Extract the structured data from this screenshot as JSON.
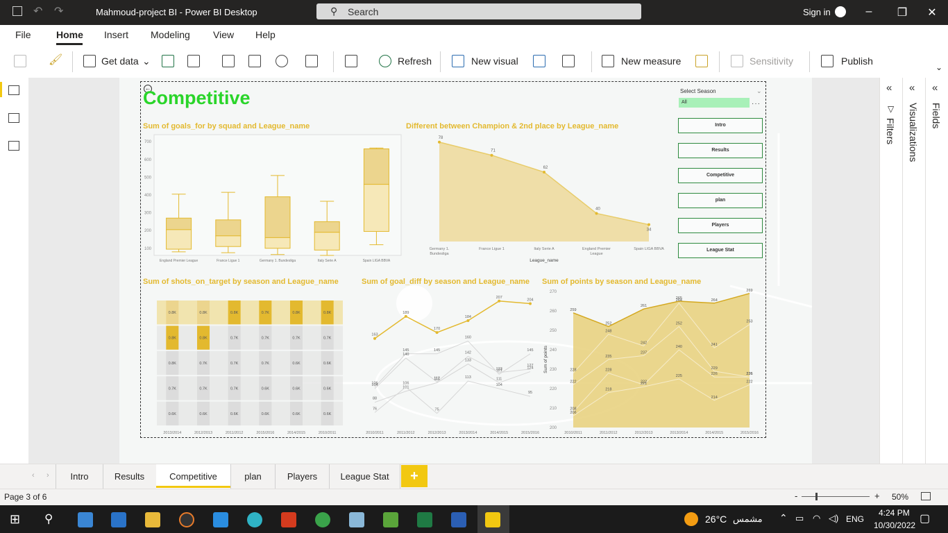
{
  "titlebar": {
    "title": "Mahmoud-project BI - Power BI Desktop",
    "search_placeholder": "Search",
    "sign_in": "Sign in"
  },
  "menu": {
    "items": [
      "File",
      "Home",
      "Insert",
      "Modeling",
      "View",
      "Help"
    ],
    "active": "Home"
  },
  "ribbon": {
    "get_data": "Get data",
    "refresh": "Refresh",
    "new_visual": "New visual",
    "new_measure": "New measure",
    "sensitivity": "Sensitivity",
    "publish": "Publish"
  },
  "report": {
    "page_title": "Competitive",
    "slicer": {
      "title": "Select Season",
      "value": "All"
    },
    "nav_buttons": [
      "Intro",
      "Results",
      "Competitive",
      "plan",
      "Players",
      "League Stat"
    ]
  },
  "panes": {
    "filters": "Filters",
    "visualizations": "Visualizations",
    "fields": "Fields"
  },
  "tabs": {
    "items": [
      "Intro",
      "Results",
      "Competitive",
      "plan",
      "Players",
      "League Stat"
    ],
    "active": "Competitive",
    "add": "+"
  },
  "status": {
    "page": "Page 3 of 6",
    "zoom": "50%"
  },
  "taskbar": {
    "temp": "26°C",
    "weather": "مشمس",
    "lang": "ENG",
    "time": "4:24 PM",
    "date": "10/30/2022"
  },
  "colors": {
    "accent": "#f2c811",
    "title_green": "#2ad52a",
    "chart_gold": "#e3b92f"
  },
  "chart_data": [
    {
      "type": "box",
      "title": "Sum of goals_for by squad and League_name",
      "categories": [
        "England Premier League",
        "France Ligue 1",
        "Germany 1. Bundesliga",
        "Italy Serie A",
        "Spain LIGA BBVA"
      ],
      "yticks": [
        "700",
        "600",
        "500",
        "400",
        "300",
        "200",
        "100"
      ],
      "ylim": [
        60,
        740
      ],
      "boxes": [
        {
          "min": 80,
          "q1": 95,
          "median": 205,
          "q3": 270,
          "max": 405
        },
        {
          "min": 75,
          "q1": 110,
          "median": 170,
          "q3": 260,
          "max": 415
        },
        {
          "min": 65,
          "q1": 100,
          "median": 160,
          "q3": 390,
          "max": 510
        },
        {
          "min": 60,
          "q1": 90,
          "median": 190,
          "q3": 250,
          "max": 365
        },
        {
          "min": 120,
          "q1": 195,
          "median": 460,
          "q3": 660,
          "max": 665
        }
      ]
    },
    {
      "type": "area",
      "title": "Different between Champion & 2nd place by League_name",
      "xlabel": "League_name",
      "categories": [
        "Germany 1. Bundesliga",
        "France Ligue 1",
        "Italy Serie A",
        "England Premier League",
        "Spain LIGA BBVA"
      ],
      "values": [
        78,
        71,
        62,
        40,
        34
      ],
      "ylim": [
        25,
        82
      ]
    },
    {
      "type": "ribbon",
      "title": "Sum of shots_on_target by season and League_name",
      "categories": [
        "2013/2014",
        "2012/2013",
        "2011/2012",
        "2015/2016",
        "2014/2015",
        "2010/2011"
      ],
      "labels": [
        [
          "0.8K",
          "0.8K",
          "0.8K",
          "0.7K",
          "0.6K"
        ],
        [
          "0.8K",
          "0.8K",
          "0.7K",
          "0.7K",
          "0.6K"
        ],
        [
          "0.8K",
          "0.7K",
          "0.7K",
          "0.7K",
          "0.6K"
        ],
        [
          "0.7K",
          "0.7K",
          "0.7K",
          "0.6K",
          "0.6K"
        ],
        [
          "0.8K",
          "0.7K",
          "0.6K",
          "0.6K",
          "0.6K"
        ],
        [
          "0.8K",
          "0.7K",
          "0.6K",
          "0.6K",
          "0.6K"
        ]
      ]
    },
    {
      "type": "line",
      "title": "Sum of goal_diff by season and League_name",
      "x": [
        "2010/2011",
        "2011/2012",
        "2012/2013",
        "2013/2014",
        "2014/2015",
        "2015/2016"
      ],
      "ylim": [
        60,
        215
      ],
      "series": [
        {
          "values": [
            163,
            189,
            170,
            184,
            207,
            204
          ],
          "highlight": true
        },
        {
          "values": [
            106,
            145,
            145,
            160,
            121,
            145
          ]
        },
        {
          "values": [
            104,
            140,
            112,
            142,
            123,
            127
          ]
        },
        {
          "values": [
            88,
            101,
            111,
            133,
            111,
            124
          ]
        },
        {
          "values": [
            76,
            106,
            75,
            113,
            104,
            95
          ]
        }
      ]
    },
    {
      "type": "area",
      "title": "Sum of points by season and League_name",
      "ylabel": "Sum of points",
      "x": [
        "2010/2011",
        "2011/2012",
        "2012/2013",
        "2013/2014",
        "2014/2015",
        "2015/2016"
      ],
      "yticks": [
        "270",
        "260",
        "250",
        "240",
        "230",
        "220",
        "210",
        "200"
      ],
      "ylim": [
        200,
        270
      ],
      "series": [
        {
          "values": [
            259,
            252,
            261,
            265,
            264,
            269
          ],
          "highlight": true
        },
        {
          "values": [
            228,
            248,
            242,
            264,
            241,
            253
          ]
        },
        {
          "values": [
            222,
            235,
            237,
            252,
            229,
            226
          ]
        },
        {
          "values": [
            208,
            228,
            222,
            240,
            226,
            226
          ]
        },
        {
          "values": [
            206,
            218,
            221,
            225,
            214,
            222
          ]
        }
      ]
    }
  ]
}
